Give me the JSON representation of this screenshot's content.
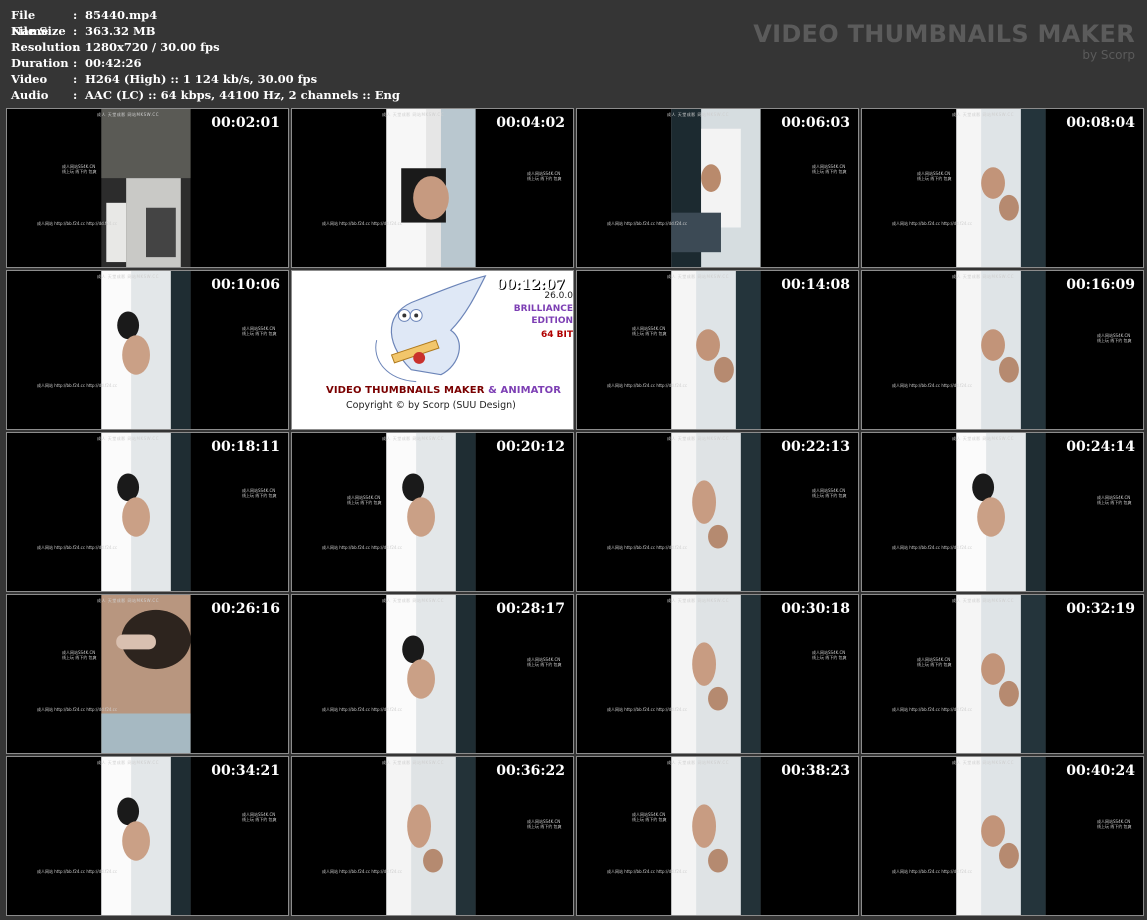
{
  "file_info": [
    {
      "label": "File Name",
      "value": "85440.mp4"
    },
    {
      "label": "File Size",
      "value": "363.32 MB"
    },
    {
      "label": "Resolution",
      "value": "1280x720 / 30.00 fps"
    },
    {
      "label": "Duration",
      "value": "00:42:26"
    },
    {
      "label": "Video",
      "value": "H264 (High) :: 1 124 kb/s, 30.00 fps"
    },
    {
      "label": "Audio",
      "value": "AAC (LC) :: 64 kbps, 44100 Hz, 2 channels :: Eng"
    }
  ],
  "brand": {
    "title": "VIDEO THUMBNAILS MAKER",
    "subtitle": "by Scorp"
  },
  "logo": {
    "title_a": "VIDEO THUMBNAILS MAKER",
    "title_amp": " & ANIMATOR",
    "copyright": "Copyright © by Scorp (SUU Design)",
    "version": "26.0.0",
    "edition_1": "BRILLIANCE",
    "edition_2": "EDITION",
    "bits": "64 BIT"
  },
  "watermarks": {
    "top": "成人 天堂成影 网站MKSW.CC",
    "mid_1": "成人网站SS4K.CN",
    "mid_2": "线上玩 线下约 包爽",
    "bottom": "成人网站 http://bb.f24.cc        http://dd.f24.cc"
  },
  "thumbnails": [
    {
      "time": "00:02:01",
      "scene": "a"
    },
    {
      "time": "00:04:02",
      "scene": "b"
    },
    {
      "time": "00:06:03",
      "scene": "c"
    },
    {
      "time": "00:08:04",
      "scene": "d"
    },
    {
      "time": "00:10:06",
      "scene": "e"
    },
    {
      "time": "00:12:07",
      "scene": "logo"
    },
    {
      "time": "00:14:08",
      "scene": "d"
    },
    {
      "time": "00:16:09",
      "scene": "d"
    },
    {
      "time": "00:18:11",
      "scene": "e"
    },
    {
      "time": "00:20:12",
      "scene": "e"
    },
    {
      "time": "00:22:13",
      "scene": "f"
    },
    {
      "time": "00:24:14",
      "scene": "e"
    },
    {
      "time": "00:26:16",
      "scene": "g"
    },
    {
      "time": "00:28:17",
      "scene": "e"
    },
    {
      "time": "00:30:18",
      "scene": "f"
    },
    {
      "time": "00:32:19",
      "scene": "d"
    },
    {
      "time": "00:34:21",
      "scene": "e"
    },
    {
      "time": "00:36:22",
      "scene": "f"
    },
    {
      "time": "00:38:23",
      "scene": "f"
    },
    {
      "time": "00:40:24",
      "scene": "d"
    }
  ],
  "colors": {
    "background": "#353535",
    "thumb_border": "#8c8c8c",
    "brand_text": "#5b5b5b"
  }
}
